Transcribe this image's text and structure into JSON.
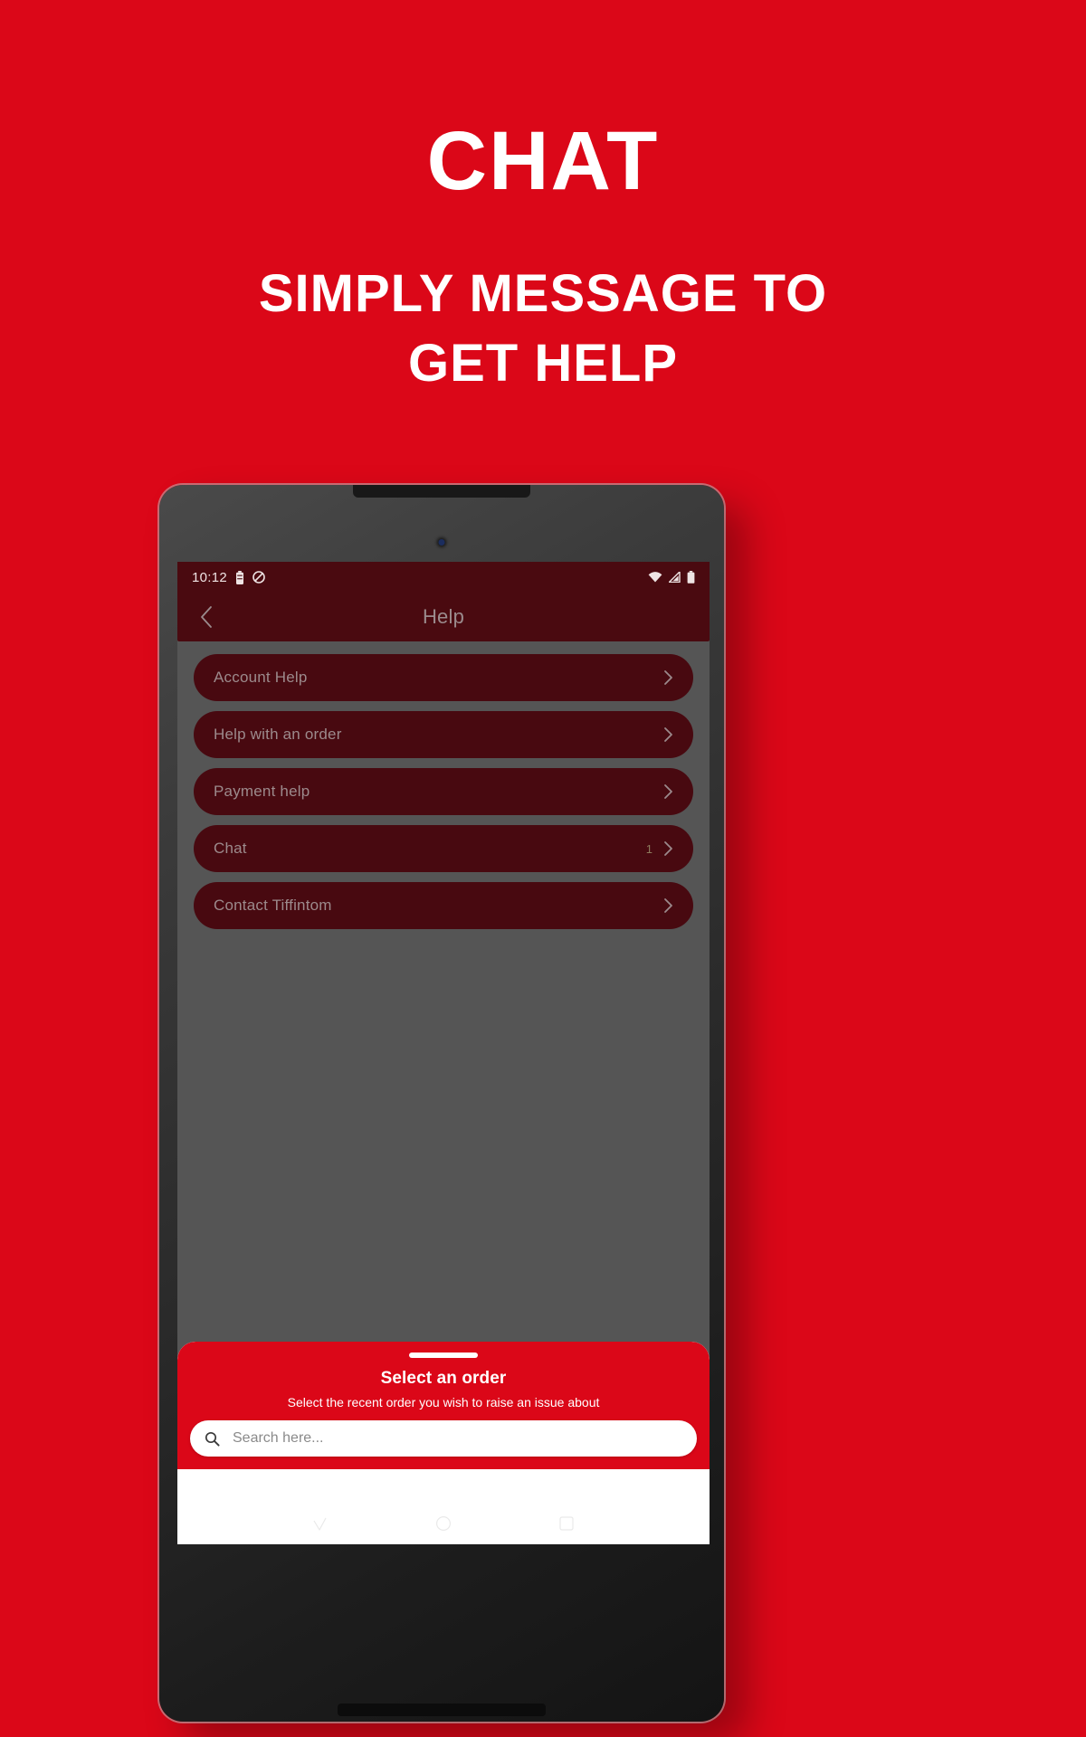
{
  "promo": {
    "title": "CHAT",
    "subtitle": "SIMPLY MESSAGE TO GET HELP",
    "background_color": "#DB0718",
    "text_color": "#FFFFFF"
  },
  "status_bar": {
    "time": "10:12",
    "left_icons": [
      "battery-icon",
      "do-not-disturb-icon"
    ],
    "right_icons": [
      "wifi-icon",
      "cellular-signal-icon",
      "battery-icon"
    ],
    "background_color": "#4A0A10"
  },
  "app_bar": {
    "back_icon": "chevron-left-icon",
    "title": "Help",
    "background_color": "#4A0A10",
    "title_color": "#9B8B8D"
  },
  "menu": {
    "items": [
      {
        "label": "Account Help",
        "badge": "",
        "chevron": "chevron-right-icon"
      },
      {
        "label": "Help with an order",
        "badge": "",
        "chevron": "chevron-right-icon"
      },
      {
        "label": "Payment help",
        "badge": "",
        "chevron": "chevron-right-icon"
      },
      {
        "label": "Chat",
        "badge": "1",
        "chevron": "chevron-right-icon"
      },
      {
        "label": "Contact Tiffintom",
        "badge": "",
        "chevron": "chevron-right-icon"
      }
    ],
    "item_color": "#480910",
    "dimmed_background": "#555555"
  },
  "bottom_sheet": {
    "title": "Select an order",
    "subtitle": "Select the recent order you wish to raise an issue about",
    "accent_color": "#DB0718",
    "search": {
      "icon": "search-icon",
      "value": "",
      "placeholder": "Search here..."
    },
    "results": []
  },
  "android_nav": {
    "buttons": [
      "back-nav-button",
      "home-nav-button",
      "recents-nav-button"
    ]
  }
}
